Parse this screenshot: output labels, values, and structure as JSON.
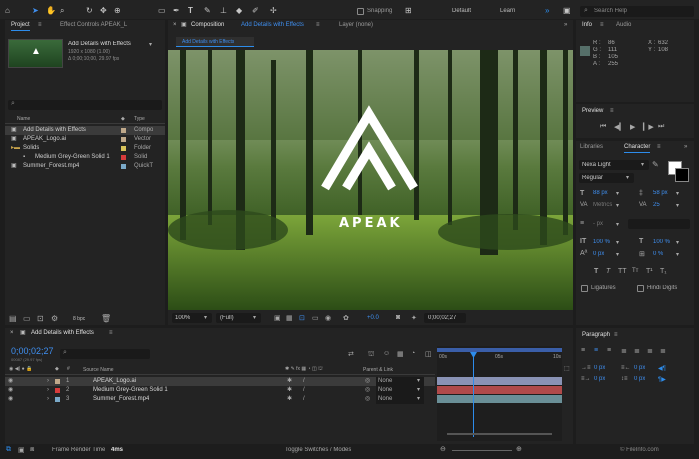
{
  "toolbar": {
    "snapping_label": "Snapping",
    "workspaces": [
      "Default",
      "Learn"
    ],
    "search_placeholder": "Search Help",
    "colors": {
      "accent": "#2d8ceb",
      "tool_active": "#2d8ceb"
    }
  },
  "project_panel": {
    "tab_project": "Project",
    "tab_effect_controls": "Effect Controls APEAK_L",
    "selected_name": "Add Details with Effects",
    "selected_info_1": "1920 x 1080 (1.00)",
    "selected_info_2": "Δ 0;00;10;00, 29.97 fps",
    "search_placeholder": "",
    "col_name": "Name",
    "col_type": "Type",
    "items": [
      {
        "name": "Add Details with Effects",
        "type": "Compo",
        "color": "#bfa88a",
        "icon": "composition-icon",
        "selected": true
      },
      {
        "name": "APEAK_Logo.ai",
        "type": "Vector",
        "color": "#bfa88a",
        "icon": "vector-file-icon"
      },
      {
        "name": "Solids",
        "type": "Folder",
        "color": "#d8c35a",
        "icon": "folder-icon"
      },
      {
        "name": "Medium Grey-Green Solid 1",
        "type": "Solid",
        "color": "#d63b3b",
        "icon": "solid-icon"
      },
      {
        "name": "Summer_Forest.mp4",
        "type": "QuickT",
        "color": "#7aa9c8",
        "icon": "video-file-icon"
      }
    ],
    "bpc": "8 bpc"
  },
  "composition_panel": {
    "tab_label": "Composition",
    "tab_comp_name": "Add Details with Effects",
    "layer_tab": "Layer (none)",
    "sub_tab": "Add Details with Effects",
    "logo_text": "APEAK",
    "zoom": "100%",
    "resolution": "(Full)",
    "exposure": "+0.0",
    "timecode": "0;00;02;27"
  },
  "info_panel": {
    "tab_info": "Info",
    "tab_audio": "Audio",
    "r_label": "R :",
    "r_value": "86",
    "g_label": "G :",
    "g_value": "111",
    "b_label": "B :",
    "b_value": "105",
    "a_label": "A :",
    "a_value": "255",
    "x_label": "X :",
    "x_value": "632",
    "y_label": "Y :",
    "y_value": "108",
    "swatch": "#566f69"
  },
  "preview_panel": {
    "title": "Preview"
  },
  "character_panel": {
    "tab_libraries": "Libraries",
    "tab_character": "Character",
    "font_name": "Nexa Light",
    "font_style": "Regular",
    "font_size": "88 px",
    "leading": "58 px",
    "kerning": "Metrics",
    "tracking": "25",
    "stroke_width": "- px",
    "vert_scale": "100 %",
    "horiz_scale": "100 %",
    "baseline": "0 px",
    "tsume": "0 %",
    "ligatures": "Ligatures",
    "hindi_digits": "Hindi Digits"
  },
  "paragraph_panel": {
    "title": "Paragraph",
    "indent_left": "0 px",
    "indent_first": "0 px",
    "indent_right": "0 px",
    "space_before": "0 px",
    "space_after": "0 px"
  },
  "timeline_panel": {
    "tab_label": "Add Details with Effects",
    "timecode": "0;00;02;27",
    "timecode_sub": "00087 (29.97 fps)",
    "col_source_name": "Source Name",
    "col_parent": "Parent & Link",
    "ruler": [
      "00s",
      "05s",
      "10s"
    ],
    "layers": [
      {
        "index": "1",
        "name": "APEAK_Logo.ai",
        "color": "#bfa88a",
        "parent": "None",
        "bar_color": "#8a93b5",
        "selected": true
      },
      {
        "index": "2",
        "name": "Medium Grey-Green Solid 1",
        "color": "#d63b3b",
        "parent": "None",
        "bar_color": "#b04a4a"
      },
      {
        "index": "3",
        "name": "Summer_Forest.mp4",
        "color": "#7aa9c8",
        "parent": "None",
        "bar_color": "#6a8f97"
      }
    ],
    "playhead_fraction": 0.29
  },
  "status_bar": {
    "frame_render_label": "Frame Render Time",
    "frame_render_value": "4ms",
    "toggle_label": "Toggle Switches / Modes",
    "watermark": "© FileInfo.com"
  }
}
